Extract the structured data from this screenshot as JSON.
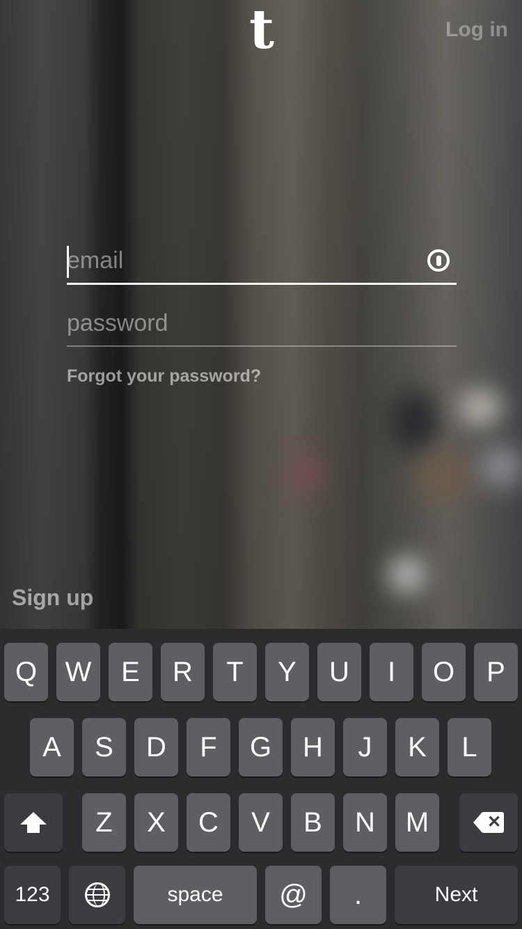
{
  "app": {
    "brand_letter": "t",
    "login_link": "Log in"
  },
  "form": {
    "email_placeholder": "email",
    "password_placeholder": "password",
    "forgot_link": "Forgot your password?",
    "signup_link": "Sign up"
  },
  "keyboard": {
    "row1": [
      "Q",
      "W",
      "E",
      "R",
      "T",
      "Y",
      "U",
      "I",
      "O",
      "P"
    ],
    "row2": [
      "A",
      "S",
      "D",
      "F",
      "G",
      "H",
      "J",
      "K",
      "L"
    ],
    "row3": [
      "Z",
      "X",
      "C",
      "V",
      "B",
      "N",
      "M"
    ],
    "bottom": {
      "numbers": "123",
      "space": "space",
      "at": "@",
      "dot": ".",
      "next": "Next"
    }
  }
}
